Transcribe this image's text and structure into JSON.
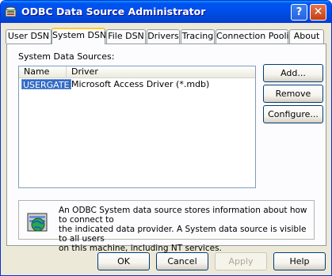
{
  "window": {
    "title": "ODBC Data Source Administrator",
    "help_button": "?",
    "close_button": "✕"
  },
  "tabs": [
    {
      "label": "User DSN"
    },
    {
      "label": "System DSN",
      "active": true
    },
    {
      "label": "File DSN"
    },
    {
      "label": "Drivers"
    },
    {
      "label": "Tracing"
    },
    {
      "label": "Connection Pooling"
    },
    {
      "label": "About"
    }
  ],
  "system_dsn": {
    "caption": "System Data Sources:",
    "columns": [
      "Name",
      "Driver"
    ],
    "rows": [
      {
        "name": "USERGATE",
        "driver": "Microsoft Access Driver (*.mdb)",
        "selected": true
      }
    ],
    "add_label": "Add...",
    "remove_label": "Remove",
    "configure_label": "Configure...",
    "info_text": "An ODBC System data source stores information about how to connect to\nthe indicated data provider.   A System data source is visible to all users\non this machine, including NT services."
  },
  "footer": {
    "ok_label": "OK",
    "cancel_label": "Cancel",
    "apply_label": "Apply",
    "help_label": "Help"
  },
  "colors": {
    "titlebar": "#0053ee",
    "selection": "#316ac5",
    "active_tab_accent": "#ffc83c"
  },
  "icons": {
    "app": "odbc-database-icon",
    "info": "globe-database-icon"
  }
}
